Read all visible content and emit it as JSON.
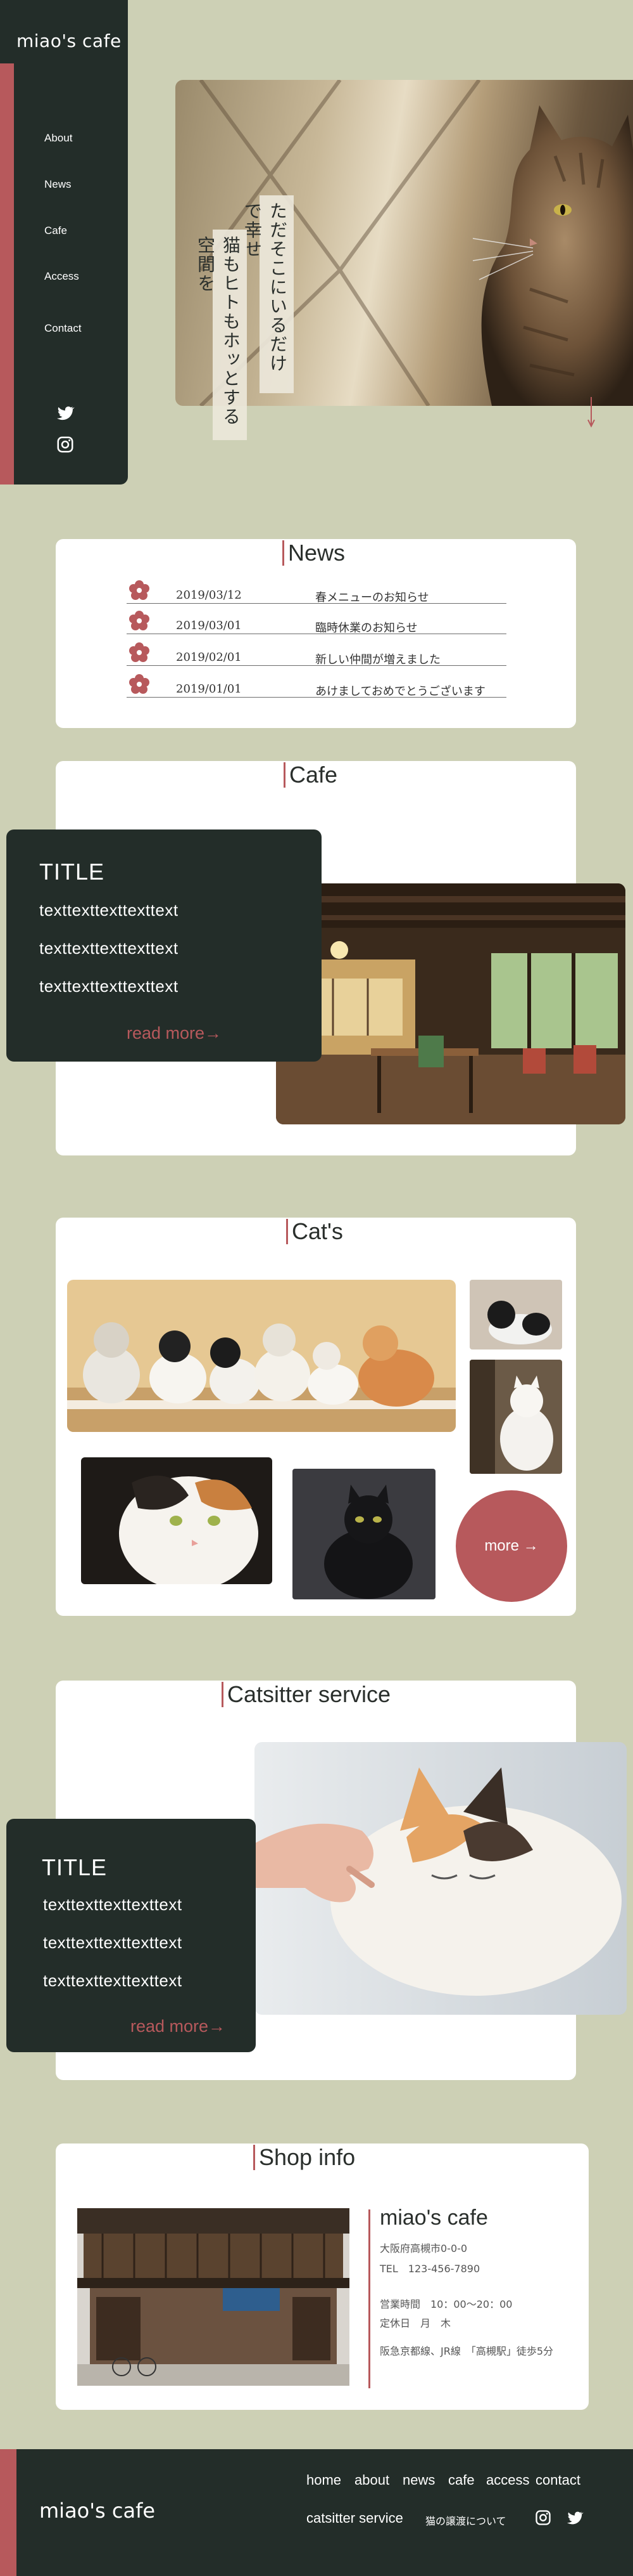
{
  "brand": {
    "logo": "miao's cafe",
    "accent_color": "#b7595c",
    "dark_color": "#232d29",
    "background_color": "#cdd0b5"
  },
  "sidebar": {
    "nav": [
      {
        "label": "About"
      },
      {
        "label": "News"
      },
      {
        "label": "Cafe"
      },
      {
        "label": "Access"
      },
      {
        "label": "Contact"
      }
    ],
    "icons": [
      "twitter-icon",
      "instagram-icon"
    ]
  },
  "hero": {
    "tagline_1": "ただそこにいるだけで幸せ",
    "tagline_2": "猫もヒトもホッとする空間を"
  },
  "news": {
    "title": "News",
    "items": [
      {
        "date": "2019/03/12",
        "text": "春メニューのお知らせ"
      },
      {
        "date": "2019/03/01",
        "text": "臨時休業のお知らせ"
      },
      {
        "date": "2019/02/01",
        "text": "新しい仲間が増えました"
      },
      {
        "date": "2019/01/01",
        "text": "あけましておめでとうございます"
      }
    ]
  },
  "cafe": {
    "title": "Cafe",
    "box_title": "TITLE",
    "lines": [
      "texttexttexttexttext",
      "texttexttexttexttext",
      "texttexttexttexttext"
    ],
    "read_more": "read more→"
  },
  "cats": {
    "title": "Cat's",
    "more": "more →"
  },
  "catsitter": {
    "title": "Catsitter service",
    "box_title": "TITLE",
    "lines": [
      "texttexttexttexttext",
      "texttexttexttexttext",
      "texttexttexttexttext"
    ],
    "read_more": "read more→"
  },
  "shop": {
    "title": "Shop info",
    "name": "miao's cafe",
    "address": "大阪府高槻市0-0-0",
    "tel": "TEL　123-456-7890",
    "hours": "営業時間　10：00〜20：00",
    "closed": "定休日　月　木",
    "access": "阪急京都線、JR線　「高槻駅」徒歩5分"
  },
  "footer": {
    "logo": "miao's cafe",
    "links": [
      "home",
      "about",
      "news",
      "cafe",
      "access",
      "contact"
    ],
    "catsitter": "catsitter service",
    "sub": "猫の譲渡について"
  }
}
